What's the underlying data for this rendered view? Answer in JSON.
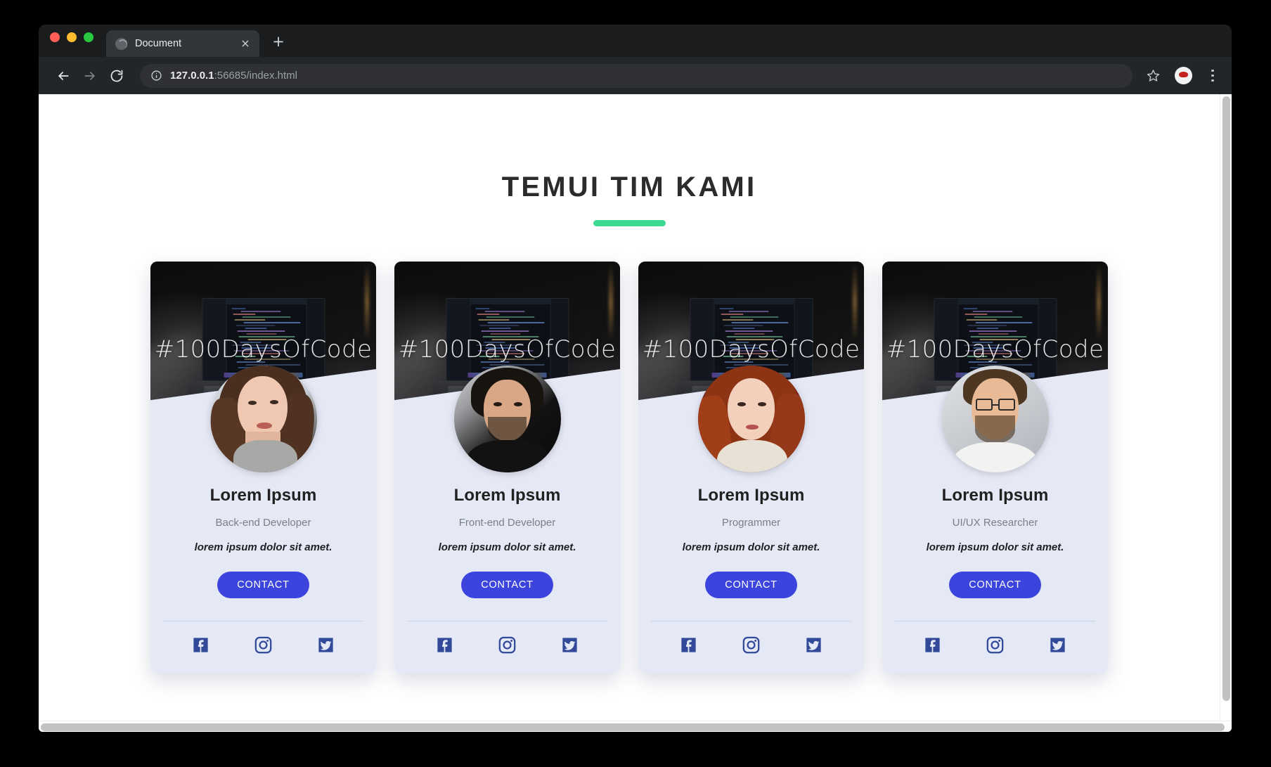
{
  "browser": {
    "tab": {
      "title": "Document",
      "favicon": "globe-icon",
      "close": "×"
    },
    "new_tab": "+",
    "url": {
      "host": "127.0.0.1",
      "path": ":56685/index.html"
    },
    "nav": {
      "back": "back-arrow-icon",
      "forward": "forward-arrow-icon",
      "reload": "reload-icon"
    },
    "actions": {
      "bookmark": "star-icon",
      "profile": "profile-avatar",
      "menu": "three-dots-icon"
    },
    "traffic_lights": {
      "close": "#ff5f57",
      "minimize": "#febc2e",
      "maximize": "#28c840"
    }
  },
  "page": {
    "title": "TEMUI TIM KAMI",
    "accent_color": "#3ed992",
    "background": "#ffffff",
    "card_background": "#e5e9f6",
    "button_color": "#3b44dd",
    "social_color": "#32499a",
    "cards": [
      {
        "banner_text": "#100DaysOfCode",
        "name": "Lorem Ipsum",
        "role": "Back-end Developer",
        "description": "lorem ipsum dolor sit amet.",
        "button": "CONTACT",
        "avatar": "portrait-woman-brown-hair",
        "social": [
          "facebook-icon",
          "instagram-icon",
          "twitter-icon"
        ]
      },
      {
        "banner_text": "#100DaysOfCode",
        "name": "Lorem Ipsum",
        "role": "Front-end Developer",
        "description": "lorem ipsum dolor sit amet.",
        "button": "CONTACT",
        "avatar": "portrait-man-dark-hair",
        "social": [
          "facebook-icon",
          "instagram-icon",
          "twitter-icon"
        ]
      },
      {
        "banner_text": "#100DaysOfCode",
        "name": "Lorem Ipsum",
        "role": "Programmer",
        "description": "lorem ipsum dolor sit amet.",
        "button": "CONTACT",
        "avatar": "portrait-woman-red-hair",
        "social": [
          "facebook-icon",
          "instagram-icon",
          "twitter-icon"
        ]
      },
      {
        "banner_text": "#100DaysOfCode",
        "name": "Lorem Ipsum",
        "role": "UI/UX Researcher",
        "description": "lorem ipsum dolor sit amet.",
        "button": "CONTACT",
        "avatar": "portrait-man-glasses",
        "social": [
          "facebook-icon",
          "instagram-icon",
          "twitter-icon"
        ]
      }
    ]
  }
}
